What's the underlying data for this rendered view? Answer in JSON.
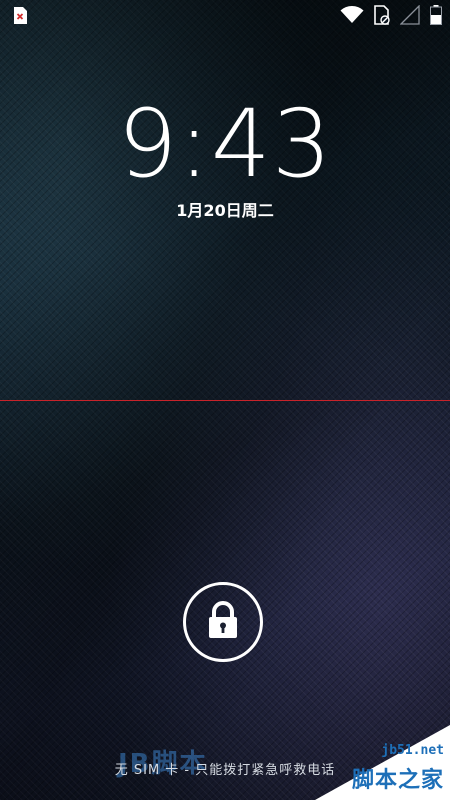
{
  "status_bar": {
    "left_icons": [
      "sim-error-icon"
    ],
    "right_icons": [
      "wifi-icon",
      "sim-card-icon",
      "cell-signal-icon",
      "battery-icon"
    ]
  },
  "lockscreen": {
    "time": "9:43",
    "date": "1月20日周二",
    "unlock_icon": "lock-icon",
    "sim_message": "无 SIM 卡 - 只能拨打紧急呼救电话"
  },
  "watermark": {
    "left_text": "JB脚本",
    "corner_url": "jb51.net",
    "corner_title": "脚本之家"
  },
  "colors": {
    "guideline": "#c8232a",
    "sim_error": "#d32f2f",
    "watermark_blue": "#1d6fb8"
  }
}
